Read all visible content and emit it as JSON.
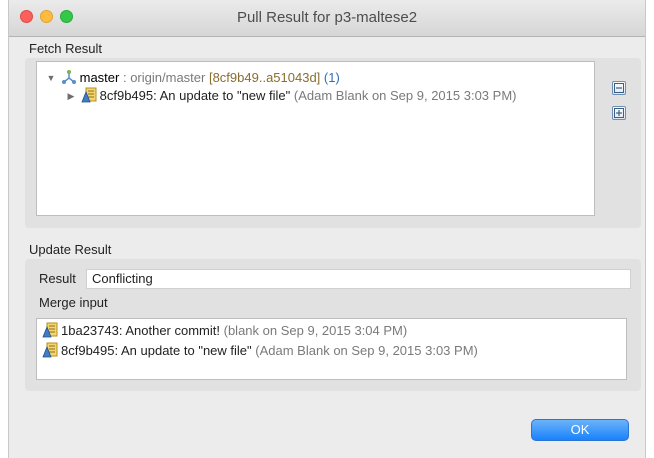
{
  "window": {
    "title": "Pull Result for p3-maltese2"
  },
  "fetch": {
    "section_label": "Fetch Result",
    "branch": {
      "name": "master",
      "separator": " : ",
      "remote": "origin/master",
      "range": "[8cf9b49..a51043d]",
      "count": "(1)"
    },
    "commit": {
      "title": "8cf9b495: An update to \"new file\"",
      "meta": "(Adam Blank on Sep 9, 2015 3:03 PM)"
    },
    "buttons": {
      "collapse_icon": "collapse-all-icon",
      "expand_icon": "expand-all-icon"
    }
  },
  "update": {
    "section_label": "Update Result",
    "result_label": "Result",
    "result_value": "Conflicting",
    "merge_label": "Merge input",
    "merge_items": [
      {
        "title": "1ba23743: Another commit!",
        "meta": "(blank on Sep 9, 2015 3:04 PM)"
      },
      {
        "title": "8cf9b495: An update to \"new file\"",
        "meta": "(Adam Blank on Sep 9, 2015 3:03 PM)"
      }
    ]
  },
  "footer": {
    "ok_label": "OK"
  },
  "colors": {
    "accent": "#1a82fb",
    "range": "#8a6d2f",
    "count": "#2f6fb5",
    "meta": "#7a7a7a"
  }
}
